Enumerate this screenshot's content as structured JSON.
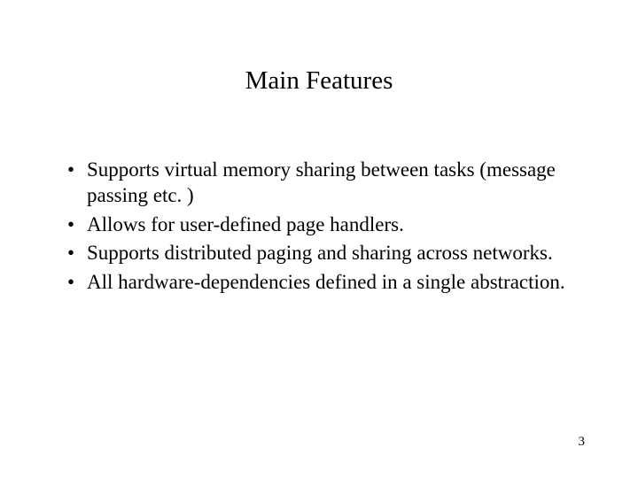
{
  "title": "Main Features",
  "bullets": [
    "Supports virtual memory sharing between tasks (message passing etc. )",
    "Allows for user-defined page handlers.",
    "Supports distributed paging and sharing across networks.",
    "All hardware-dependencies defined in a single abstraction."
  ],
  "page_number": "3"
}
